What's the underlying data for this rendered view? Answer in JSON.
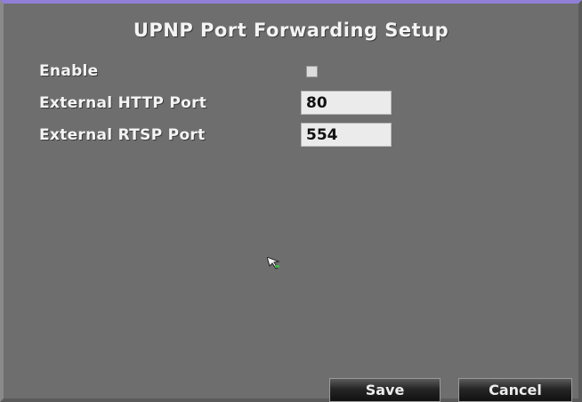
{
  "dialog": {
    "title": "UPNP Port Forwarding Setup"
  },
  "fields": {
    "enable_label": "Enable",
    "enable_checked": false,
    "http_port_label": "External HTTP Port",
    "http_port_value": "80",
    "rtsp_port_label": "External RTSP Port",
    "rtsp_port_value": "554"
  },
  "buttons": {
    "save_label": "Save",
    "cancel_label": "Cancel"
  },
  "icons": {
    "cursor": "mouse-pointer-icon"
  }
}
